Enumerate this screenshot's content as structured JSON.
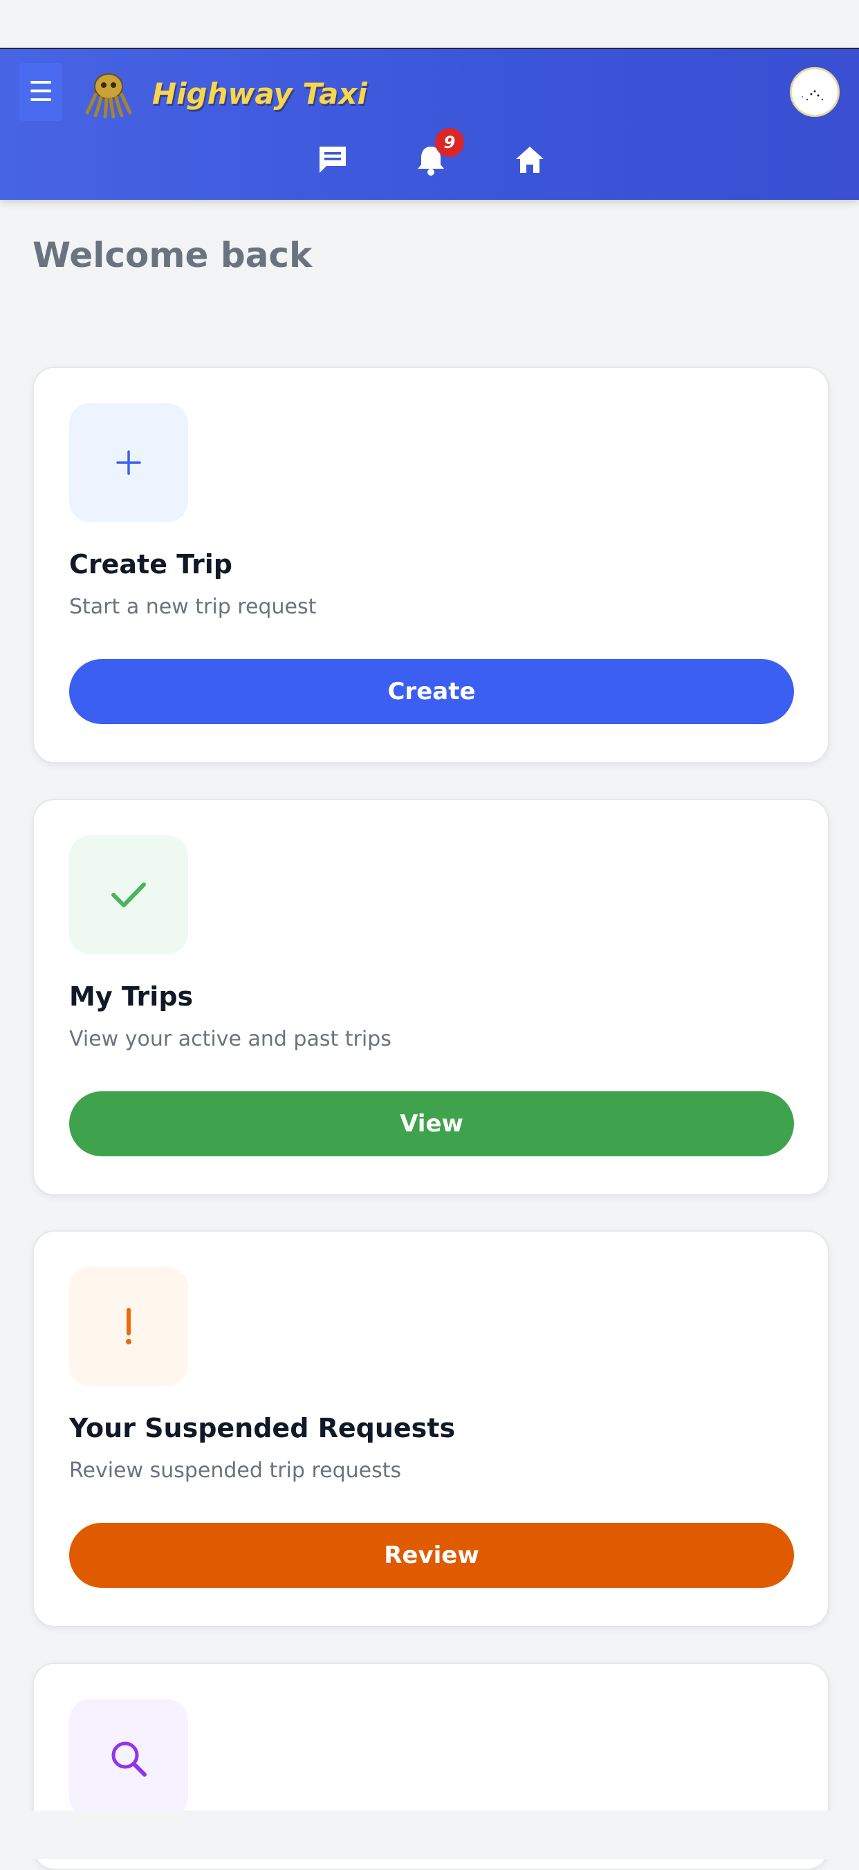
{
  "header": {
    "brand": "Highway Taxi",
    "menu_icon": "menu-icon",
    "logo_icon": "octopus-logo",
    "avatar_icon": "user-avatar",
    "nav": [
      {
        "icon": "chat-icon",
        "label": ""
      },
      {
        "icon": "bell-icon",
        "badge": "9"
      },
      {
        "icon": "home-icon",
        "label": ""
      }
    ],
    "colors": {
      "bar": "#3b55d9",
      "brand": "#f9d64a",
      "badge": "#dc2626"
    }
  },
  "main": {
    "welcome": "Welcome back"
  },
  "cards": [
    {
      "icon": "plus-icon",
      "title": "Create Trip",
      "subtitle": "Start a new trip request",
      "button": "Create",
      "accent": "#3b5ff0",
      "icon_bg": "#eef4ff"
    },
    {
      "icon": "check-icon",
      "title": "My Trips",
      "subtitle": "View your active and past trips",
      "button": "View",
      "accent": "#3fa34d",
      "icon_bg": "#eefaf1"
    },
    {
      "icon": "exclamation-icon",
      "title": "Your Suspended Requests",
      "subtitle": "Review suspended trip requests",
      "button": "Review",
      "accent": "#e05a00",
      "icon_bg": "#fff6ee"
    },
    {
      "icon": "search-icon",
      "title": "",
      "subtitle": "",
      "button": "",
      "accent": "#9333ea",
      "icon_bg": "#f6f2ff"
    }
  ]
}
